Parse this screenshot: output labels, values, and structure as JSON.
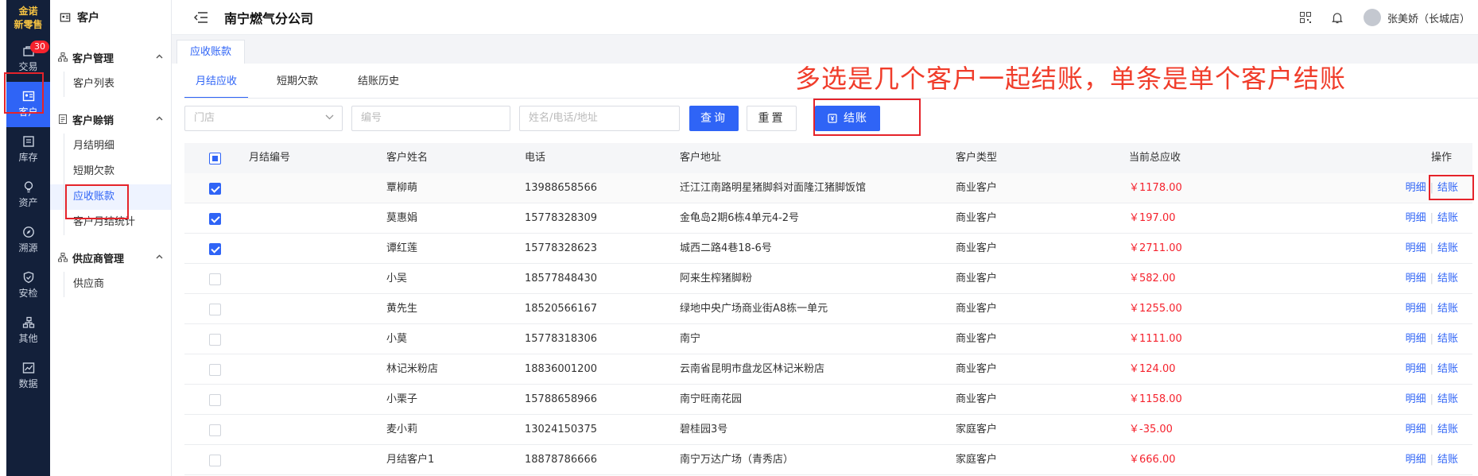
{
  "brand": {
    "line1": "金诺",
    "line2": "新零售"
  },
  "rail": [
    {
      "label": "交易",
      "icon": "bag-icon",
      "badge": "30"
    },
    {
      "label": "客户",
      "icon": "contact-card-icon",
      "active": true
    },
    {
      "label": "库存",
      "icon": "inventory-icon"
    },
    {
      "label": "资产",
      "icon": "bulb-icon"
    },
    {
      "label": "溯源",
      "icon": "compass-icon"
    },
    {
      "label": "安检",
      "icon": "shield-check-icon"
    },
    {
      "label": "其他",
      "icon": "nodes-icon"
    },
    {
      "label": "数据",
      "icon": "chart-icon"
    }
  ],
  "sidebar": {
    "title": "客户",
    "groups": [
      {
        "label": "客户管理",
        "items": [
          "客户列表"
        ]
      },
      {
        "label": "客户赊销",
        "items": [
          "月结明细",
          "短期欠款",
          "应收账款",
          "客户月结统计"
        ]
      },
      {
        "label": "供应商管理",
        "items": [
          "供应商"
        ]
      }
    ]
  },
  "header": {
    "company": "南宁燃气分公司",
    "user": "张美娇（长城店）"
  },
  "page_tab": "应收账款",
  "tabs": [
    "月结应收",
    "短期欠款",
    "结账历史"
  ],
  "annotation": "多选是几个客户一起结账，单条是单个客户结账",
  "filters": {
    "store_placeholder": "门店",
    "number_placeholder": "编号",
    "name_placeholder": "姓名/电话/地址",
    "query": "查询",
    "reset": "重置",
    "settle": "结账"
  },
  "table": {
    "columns": [
      "月结编号",
      "客户姓名",
      "电话",
      "客户地址",
      "客户类型",
      "当前总应收",
      "操作"
    ],
    "op_detail": "明细",
    "op_settle": "结账",
    "rows": [
      {
        "checked": true,
        "name": "覃柳萌",
        "phone": "13988658566",
        "address": "迁江江南路明星猪脚斜对面隆江猪脚饭馆",
        "type": "商业客户",
        "amount": "￥1178.00"
      },
      {
        "checked": true,
        "name": "莫惠娟",
        "phone": "15778328309",
        "address": "金龟岛2期6栋4单元4-2号",
        "type": "商业客户",
        "amount": "￥197.00"
      },
      {
        "checked": true,
        "name": "谭红莲",
        "phone": "15778328623",
        "address": "城西二路4巷18-6号",
        "type": "商业客户",
        "amount": "￥2711.00"
      },
      {
        "checked": false,
        "name": "小吴",
        "phone": "18577848430",
        "address": "阿来生榨猪脚粉",
        "type": "商业客户",
        "amount": "￥582.00"
      },
      {
        "checked": false,
        "name": "黄先生",
        "phone": "18520566167",
        "address": "绿地中央广场商业街A8栋一单元",
        "type": "商业客户",
        "amount": "￥1255.00"
      },
      {
        "checked": false,
        "name": "小莫",
        "phone": "15778318306",
        "address": "南宁",
        "type": "商业客户",
        "amount": "￥1111.00"
      },
      {
        "checked": false,
        "name": "林记米粉店",
        "phone": "18836001200",
        "address": "云南省昆明市盘龙区林记米粉店",
        "type": "商业客户",
        "amount": "￥124.00"
      },
      {
        "checked": false,
        "name": "小栗子",
        "phone": "15788658966",
        "address": "南宁旺南花园",
        "type": "商业客户",
        "amount": "￥1158.00"
      },
      {
        "checked": false,
        "name": "麦小莉",
        "phone": "13024150375",
        "address": "碧桂园3号",
        "type": "家庭客户",
        "amount": "￥-35.00"
      },
      {
        "checked": false,
        "name": "月结客户1",
        "phone": "18878786666",
        "address": "南宁万达广场（青秀店）",
        "type": "家庭客户",
        "amount": "￥666.00"
      }
    ]
  },
  "colors": {
    "accent": "#2f64f6",
    "rail": "#13203a",
    "highlight": "#e5232a",
    "amount": "#f5222d"
  }
}
